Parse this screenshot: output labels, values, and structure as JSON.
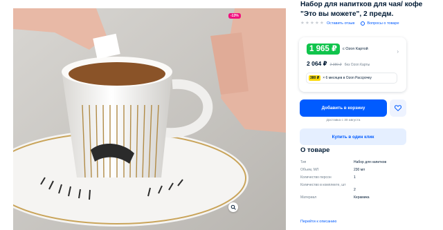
{
  "product": {
    "title": "Набор для напитков для чая/ кофе \"Это вы можете\", 2 предм.",
    "discount_badge": "-13%",
    "rating_stars": 5,
    "leave_review": "Оставить отзыв",
    "questions": "Вопросы о товаре"
  },
  "price": {
    "ozon_card_price": "1 965 ₽",
    "ozon_card_label": "с Ozon Картой",
    "regular_price": "2 064 ₽",
    "old_price": "2 380 ₽",
    "regular_label": "без Ozon Карты",
    "installment_badge": "380 ₽",
    "installment_label": "× 6 месяцев в Ozon Рассрочку"
  },
  "actions": {
    "add_to_cart": "Добавить в корзину",
    "delivery_note": "Доставка с 30 августа",
    "buy_one_click": "Купить в один клик"
  },
  "about": {
    "title": "О товаре",
    "specs": [
      {
        "key": "Тип",
        "value": "Набор для напитков"
      },
      {
        "key": "Объем, МЛ",
        "value": "230 мл"
      },
      {
        "key": "Количество персон",
        "value": "1"
      },
      {
        "key": "Количество в комплекте, шт",
        "value": "2"
      },
      {
        "key": "Материал",
        "value": "Керамика"
      }
    ],
    "go_to_description": "Перейти к описанию"
  },
  "colors": {
    "accent": "#005bff",
    "ozon_green": "#10c44c",
    "discount_pink": "#f1117e",
    "installment_yellow": "#fbd800"
  },
  "icons": [
    "star-icon",
    "review-icon",
    "question-icon",
    "chevron-right-icon",
    "heart-icon",
    "similar-search-icon"
  ]
}
